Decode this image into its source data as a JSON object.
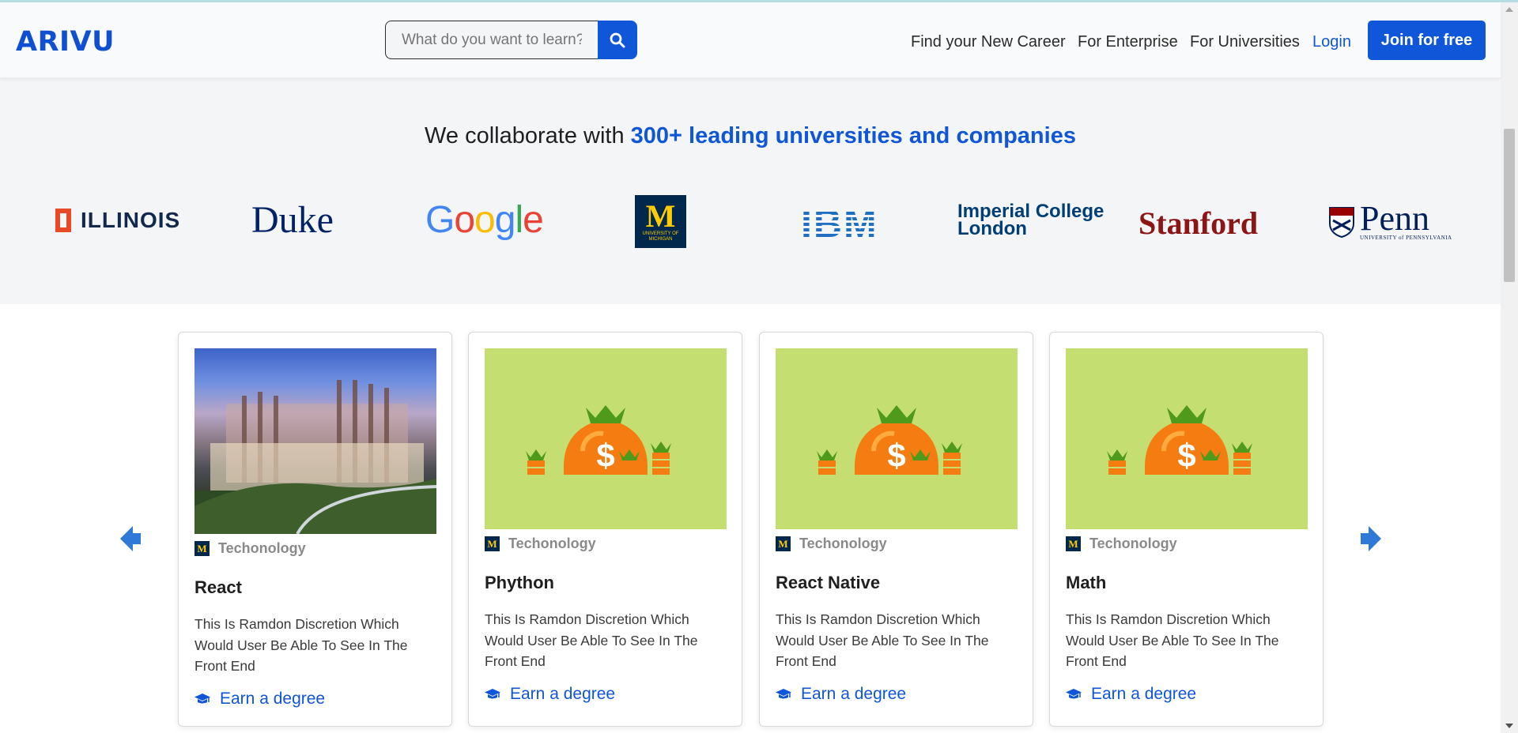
{
  "header": {
    "logo": "ARIVU",
    "search_placeholder": "What do you want to learn?",
    "nav": [
      "Find your New Career",
      "For Enterprise",
      "For Universities"
    ],
    "login": "Login",
    "join": "Join for free"
  },
  "partners": {
    "heading_prefix": "We collaborate with ",
    "heading_highlight": "300+ leading universities and companies",
    "logos": {
      "illinois": "ILLINOIS",
      "duke": "Duke",
      "google": "Google",
      "michigan": "M",
      "michigan_sub": "UNIVERSITY OF MICHIGAN",
      "ibm": "IBM",
      "imperial_line1": "Imperial College",
      "imperial_line2": "London",
      "stanford": "Stanford",
      "penn": "Penn",
      "penn_sub": "UNIVERSITY of PENNSYLVANIA"
    }
  },
  "courses": [
    {
      "category": "Techonology",
      "title": "React",
      "description": "This Is Ramdon Discretion Which Would User Be Able To See In The Front End",
      "cta": "Earn a degree",
      "image": "campus-building"
    },
    {
      "category": "Techonology",
      "title": "Phython",
      "description": "This Is Ramdon Discretion Which Would User Be Able To See In The Front End",
      "cta": "Earn a degree",
      "image": "money-bag"
    },
    {
      "category": "Techonology",
      "title": "React Native",
      "description": "This Is Ramdon Discretion Which Would User Be Able To See In The Front End",
      "cta": "Earn a degree",
      "image": "money-bag"
    },
    {
      "category": "Techonology",
      "title": "Math",
      "description": "This Is Ramdon Discretion Which Would User Be Able To See In The Front End",
      "cta": "Earn a degree",
      "image": "money-bag"
    }
  ],
  "colors": {
    "brand": "#0f56d9",
    "partner_bg": "#f4f5f7",
    "image_bg": "#c4de71"
  },
  "icons": [
    "search-icon",
    "graduation-cap-icon",
    "arrow-left-icon",
    "arrow-right-icon"
  ]
}
